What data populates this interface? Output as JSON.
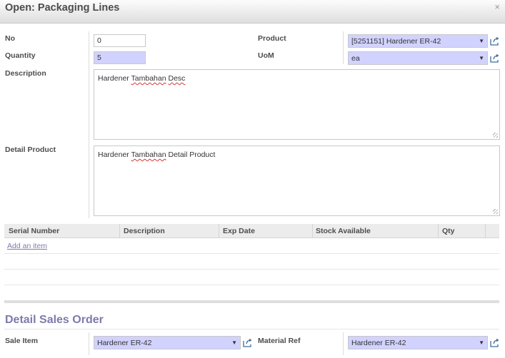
{
  "dialog": {
    "title": "Open: Packaging Lines",
    "close_glyph": "×"
  },
  "form": {
    "no": {
      "label": "No",
      "value": "0"
    },
    "quantity": {
      "label": "Quantity",
      "value": "5"
    },
    "product": {
      "label": "Product",
      "value": "[5251151] Hardener ER-42"
    },
    "uom": {
      "label": "UoM",
      "value": "ea"
    },
    "description": {
      "label": "Description",
      "value_word1": "Hardener",
      "value_word2": "Tambahan",
      "value_word3": "Desc"
    },
    "detail_product": {
      "label": "Detail Product",
      "value_word1": "Hardener",
      "value_word2": "Tambahan",
      "value_rest": "Detail Product"
    }
  },
  "table": {
    "columns": [
      "Serial Number",
      "Description",
      "Exp Date",
      "Stock Available",
      "Qty"
    ],
    "add_item_label": "Add an item"
  },
  "detail_sales_order": {
    "title": "Detail Sales Order",
    "sale_item": {
      "label": "Sale Item",
      "value": "Hardener ER-42"
    },
    "material_ref": {
      "label": "Material Ref",
      "value": "Hardener ER-42"
    }
  },
  "icons": {
    "external_link": "external-link-icon",
    "dropdown_arrow": "dropdown-arrow-icon",
    "resize_grip": "resize-grip-icon"
  },
  "colors": {
    "required_field": "#d2d2ff",
    "accent": "#7c7bad",
    "header_bg": "#e8e8e8"
  }
}
